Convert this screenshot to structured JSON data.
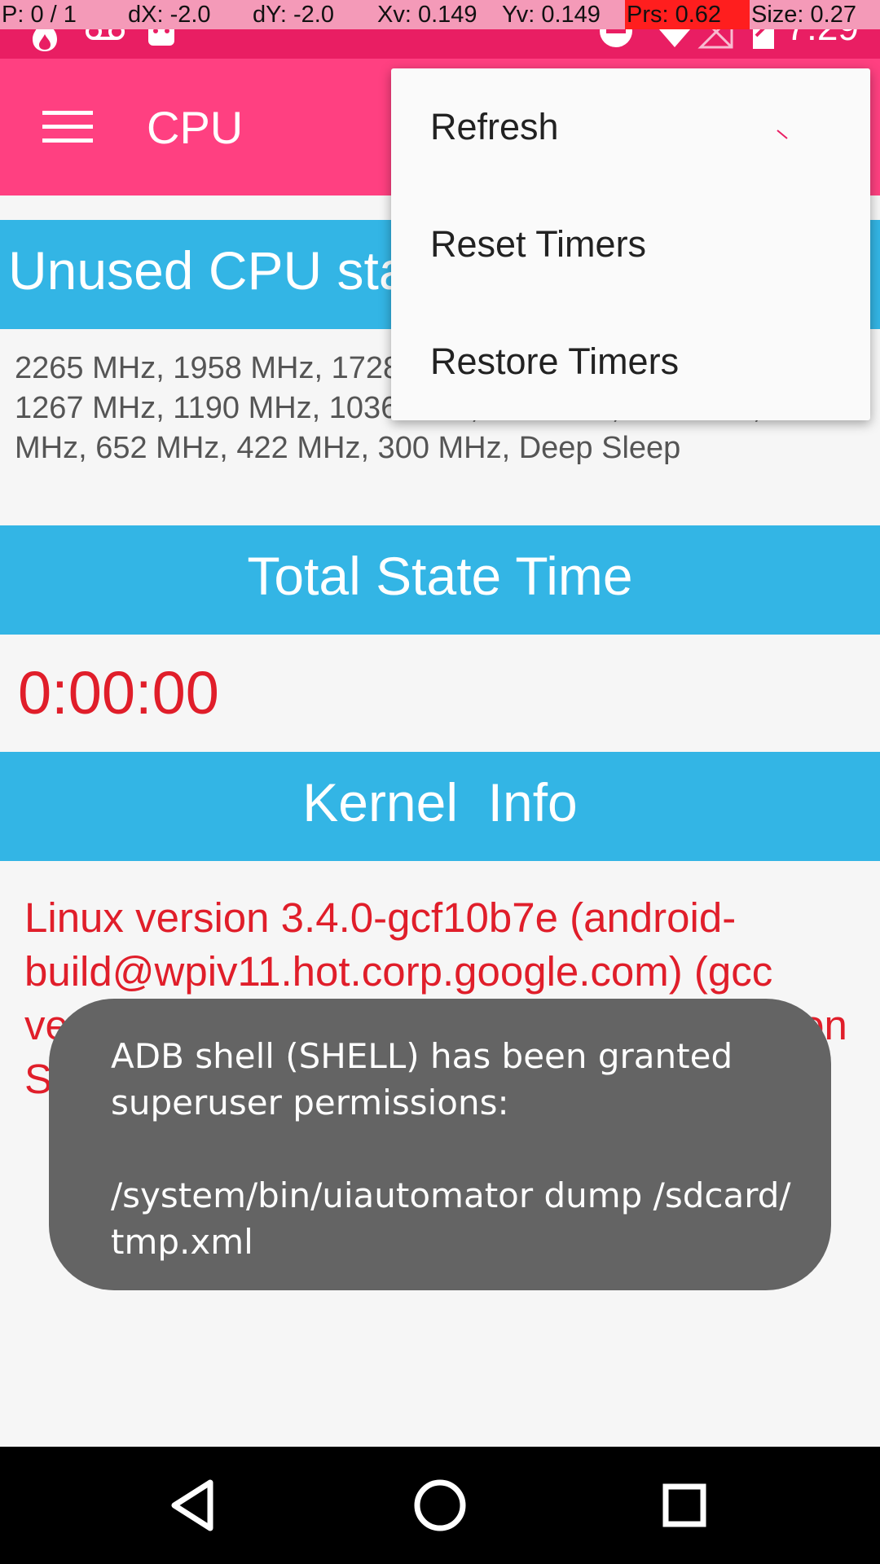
{
  "debug_overlay": {
    "pointer": "P: 0 / 1",
    "dx": "dX: -2.0",
    "dy": "dY: -2.0",
    "xv": "Xv: 0.149",
    "yv": "Yv: 0.149",
    "prs": "Prs: 0.62",
    "size": "Size: 0.27"
  },
  "status_bar": {
    "time": "7:29",
    "icons": [
      "fire-icon",
      "voicemail-icon",
      "android-icon",
      "do-not-disturb-icon",
      "wifi-icon",
      "signal-icon",
      "battery-icon"
    ]
  },
  "app_bar": {
    "title": "CPU",
    "menu_icon": "hamburger-menu-icon"
  },
  "sections": {
    "unused_states": {
      "title": "Unused CPU states",
      "text": "2265 MHz, 1958 MHz, 1728 MHz, 1574 MHz, 1497 MHz, 1267 MHz, 1190 MHz, 1036 MHz, 960 MHz, 883 MHz, 729 MHz, 652 MHz, 422 MHz, 300 MHz, Deep Sleep"
    },
    "total_state_time": {
      "title": "Total State Time",
      "value": "0:00:00"
    },
    "kernel_info": {
      "title": "Kernel  Info",
      "text": "Linux version 3.4.0-gcf10b7e (android-build@wpiv11.hot.corp.google.com) (gcc version 4.8 (GCC) ) #1 SMP PREEMPT Mon Sep 19 22:14:08 UTC 2016"
    }
  },
  "overflow_menu": {
    "items": [
      "Refresh",
      "Reset Timers",
      "Restore Timers"
    ]
  },
  "toast": {
    "line1": "ADB shell (SHELL) has been granted",
    "line2": "superuser permissions:",
    "line3": "/system/bin/uiautomator dump /sdcard/",
    "line4": "tmp.xml"
  },
  "nav_bar": {
    "buttons": [
      "back-icon",
      "home-icon",
      "recents-icon"
    ]
  },
  "colors": {
    "status_bar": "#e91e63",
    "app_bar": "#ff4081",
    "section_header": "#33b5e5",
    "accent_red": "#e01e2a",
    "toast_bg": "#646464"
  }
}
